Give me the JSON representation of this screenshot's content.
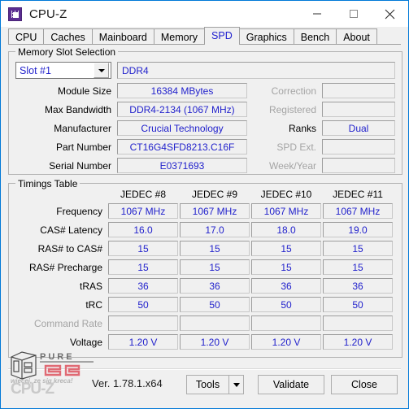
{
  "window": {
    "title": "CPU-Z",
    "icon": "cpu-chip-icon",
    "controls": {
      "minimize": "minimize-icon",
      "maximize": "maximize-icon",
      "close": "close-icon"
    },
    "border_color": "#0078d7"
  },
  "tabs": [
    {
      "label": "CPU",
      "active": false
    },
    {
      "label": "Caches",
      "active": false
    },
    {
      "label": "Mainboard",
      "active": false
    },
    {
      "label": "Memory",
      "active": false
    },
    {
      "label": "SPD",
      "active": true
    },
    {
      "label": "Graphics",
      "active": false
    },
    {
      "label": "Bench",
      "active": false
    },
    {
      "label": "About",
      "active": false
    }
  ],
  "slot_selection": {
    "legend": "Memory Slot Selection",
    "slot_combo": {
      "value": "Slot #1",
      "arrow": "chevron-down-icon"
    },
    "module_type": "DDR4",
    "left_fields": [
      {
        "label": "Module Size",
        "value": "16384 MBytes",
        "disabled": false
      },
      {
        "label": "Max Bandwidth",
        "value": "DDR4-2134 (1067 MHz)",
        "disabled": false
      },
      {
        "label": "Manufacturer",
        "value": "Crucial Technology",
        "disabled": false
      },
      {
        "label": "Part Number",
        "value": "CT16G4SFD8213.C16F",
        "disabled": false
      },
      {
        "label": "Serial Number",
        "value": "E0371693",
        "disabled": false
      }
    ],
    "right_fields": [
      {
        "label": "Correction",
        "value": "",
        "disabled": true
      },
      {
        "label": "Registered",
        "value": "",
        "disabled": true
      },
      {
        "label": "Ranks",
        "value": "Dual",
        "disabled": false
      },
      {
        "label": "SPD Ext.",
        "value": "",
        "disabled": true
      },
      {
        "label": "Week/Year",
        "value": "",
        "disabled": true
      }
    ]
  },
  "timings": {
    "legend": "Timings Table",
    "columns": [
      "JEDEC #8",
      "JEDEC #9",
      "JEDEC #10",
      "JEDEC #11"
    ],
    "rows": [
      {
        "label": "Frequency",
        "disabled": false,
        "values": [
          "1067 MHz",
          "1067 MHz",
          "1067 MHz",
          "1067 MHz"
        ]
      },
      {
        "label": "CAS# Latency",
        "disabled": false,
        "values": [
          "16.0",
          "17.0",
          "18.0",
          "19.0"
        ]
      },
      {
        "label": "RAS# to CAS#",
        "disabled": false,
        "values": [
          "15",
          "15",
          "15",
          "15"
        ]
      },
      {
        "label": "RAS# Precharge",
        "disabled": false,
        "values": [
          "15",
          "15",
          "15",
          "15"
        ]
      },
      {
        "label": "tRAS",
        "disabled": false,
        "values": [
          "36",
          "36",
          "36",
          "36"
        ]
      },
      {
        "label": "tRC",
        "disabled": false,
        "values": [
          "50",
          "50",
          "50",
          "50"
        ]
      },
      {
        "label": "Command Rate",
        "disabled": true,
        "values": [
          "",
          "",
          "",
          ""
        ]
      },
      {
        "label": "Voltage",
        "disabled": false,
        "values": [
          "1.20 V",
          "1.20 V",
          "1.20 V",
          "1.20 V"
        ]
      }
    ]
  },
  "watermark": {
    "brand_top": "PURE",
    "brand_bottom": "PC",
    "ghost_text": "CPU-Z",
    "tagline": "wiecej, ze sig kreca!"
  },
  "footer": {
    "version": "Ver. 1.78.1.x64",
    "tools_label": "Tools",
    "tools_arrow": "chevron-down-icon",
    "validate_label": "Validate",
    "close_label": "Close"
  }
}
